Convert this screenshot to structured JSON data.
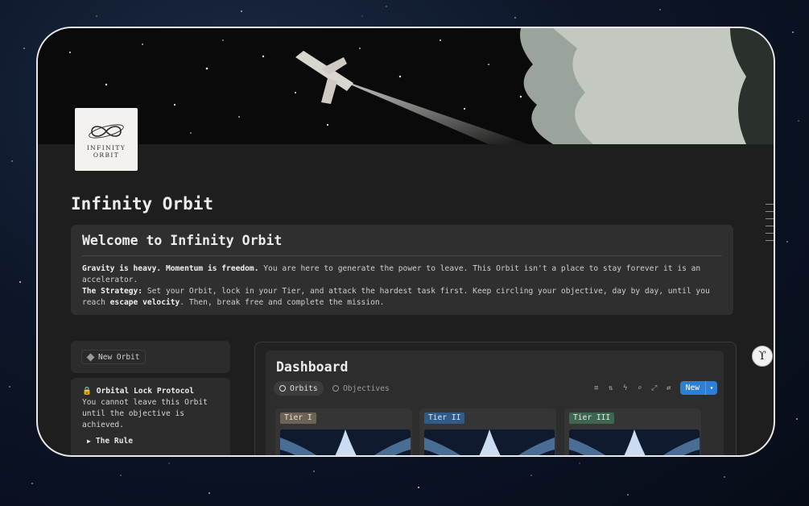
{
  "page": {
    "title": "Infinity Orbit",
    "logo_text_line1": "INFINITY",
    "logo_text_line2": "ORBIT"
  },
  "callout": {
    "heading": "Welcome to Infinity Orbit",
    "p1_bold": " Gravity is heavy. Momentum is freedom.",
    "p1_text": " You are here to generate the power to leave. This Orbit isn't a place to stay forever it is an accelerator.",
    "p2_bold": "The Strategy:",
    "p2_text_a": " Set your Orbit, lock in your Tier, and attack the hardest task first. Keep circling your objective, day by day, until you reach ",
    "p2_bold_b": "escape velocity",
    "p2_text_b": ". Then, break free and complete the mission."
  },
  "sidebar": {
    "new_orbit_label": "New Orbit",
    "lock_title": "Orbital Lock Protocol",
    "lock_text": "You cannot leave this Orbit until the objective is achieved.",
    "toggle_label": "The Rule"
  },
  "dashboard": {
    "title": "Dashboard",
    "tabs": [
      {
        "label": "Orbits",
        "active": true
      },
      {
        "label": "Objectives",
        "active": false
      }
    ],
    "new_label": "New",
    "tiers": [
      {
        "label": "Tier I",
        "color": "#6b6456",
        "text_color": "#e8e2d4"
      },
      {
        "label": "Tier II",
        "color": "#2f5a8a",
        "text_color": "#dbe8f6"
      },
      {
        "label": "Tier III",
        "color": "#3f6650",
        "text_color": "#dcefe2"
      }
    ]
  },
  "colors": {
    "accent": "#2b7fd6",
    "surface": "#1e1e1e",
    "callout": "#2f2f2f"
  }
}
